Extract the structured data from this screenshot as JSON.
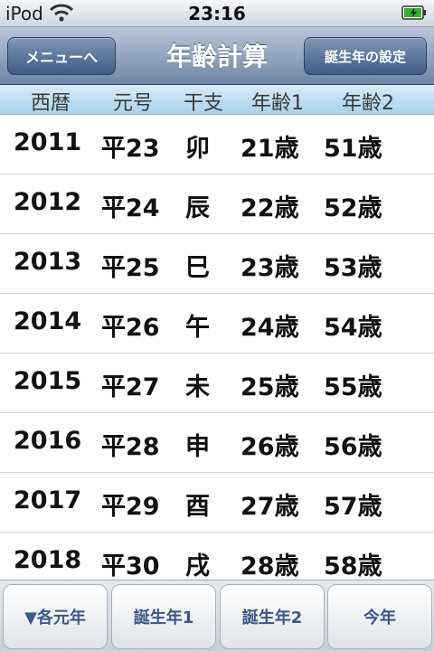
{
  "status_bar": {
    "carrier": "iPod",
    "time": "23:16"
  },
  "nav": {
    "left_button": "メニューへ",
    "title": "年齢計算",
    "right_button": "誕生年の設定"
  },
  "columns": [
    "西暦",
    "元号",
    "干支",
    "年齢1",
    "年齢2"
  ],
  "rows": [
    {
      "year": "2011",
      "era": "平23",
      "zodiac": "卯",
      "age1": "21歳",
      "age2": "51歳"
    },
    {
      "year": "2012",
      "era": "平24",
      "zodiac": "辰",
      "age1": "22歳",
      "age2": "52歳"
    },
    {
      "year": "2013",
      "era": "平25",
      "zodiac": "巳",
      "age1": "23歳",
      "age2": "53歳"
    },
    {
      "year": "2014",
      "era": "平26",
      "zodiac": "午",
      "age1": "24歳",
      "age2": "54歳"
    },
    {
      "year": "2015",
      "era": "平27",
      "zodiac": "未",
      "age1": "25歳",
      "age2": "55歳"
    },
    {
      "year": "2016",
      "era": "平28",
      "zodiac": "申",
      "age1": "26歳",
      "age2": "56歳"
    },
    {
      "year": "2017",
      "era": "平29",
      "zodiac": "酉",
      "age1": "27歳",
      "age2": "57歳"
    },
    {
      "year": "2018",
      "era": "平30",
      "zodiac": "戌",
      "age1": "28歳",
      "age2": "58歳"
    }
  ],
  "bottom_buttons": [
    "▼各元年",
    "誕生年1",
    "誕生年2",
    "今年"
  ],
  "colors": {
    "nav_top": "#b8c6d8",
    "nav_bottom": "#6d86a6",
    "header_bg": "#a9d2ea",
    "button_text": "#3b5785"
  }
}
